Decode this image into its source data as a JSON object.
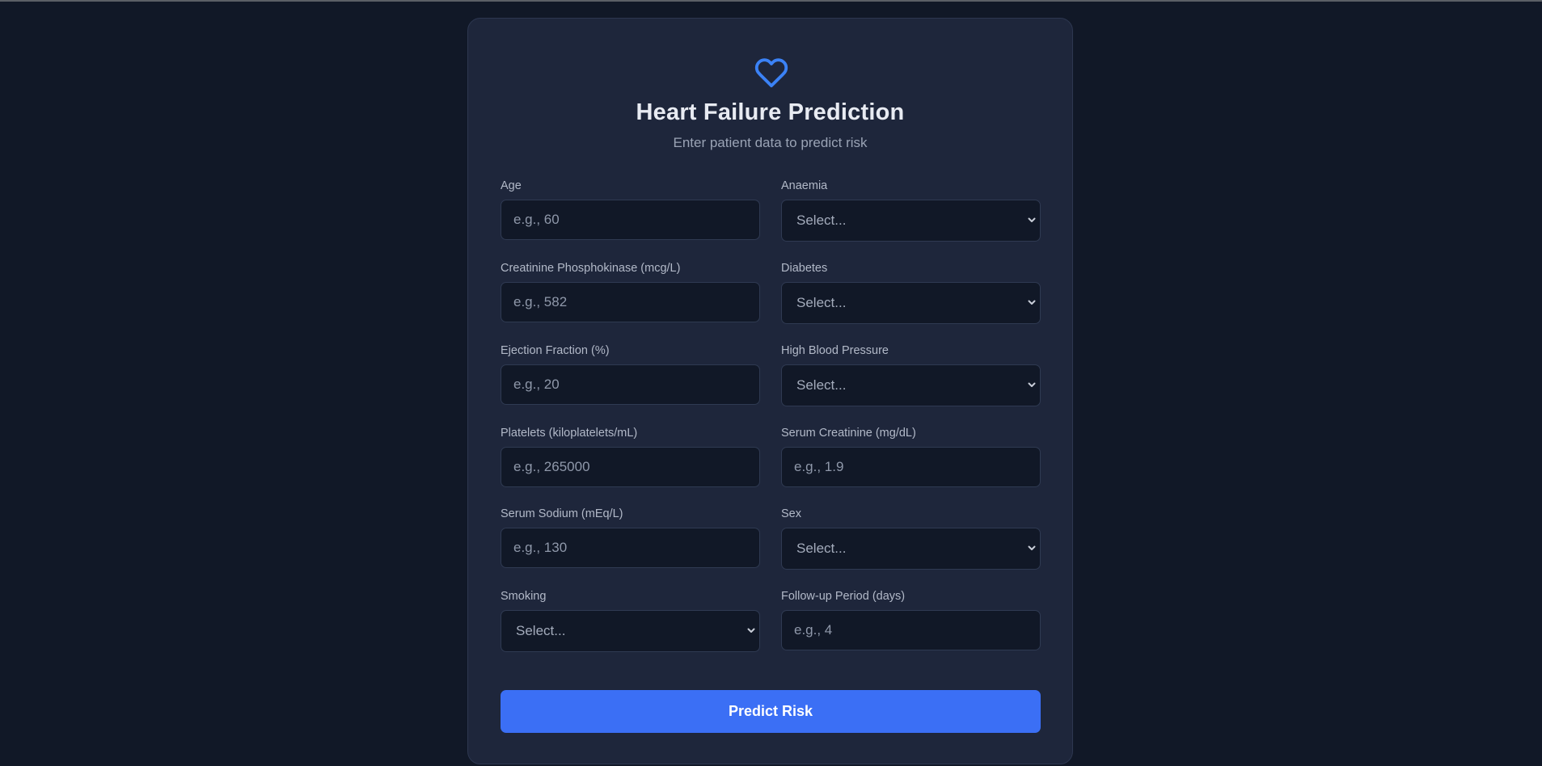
{
  "header": {
    "title": "Heart Failure Prediction",
    "subtitle": "Enter patient data to predict risk",
    "icon": "heart-icon",
    "accent_color": "#3b82f6"
  },
  "form": {
    "age": {
      "label": "Age",
      "placeholder": "e.g., 60"
    },
    "anaemia": {
      "label": "Anaemia",
      "value": "Select..."
    },
    "cpk": {
      "label": "Creatinine Phosphokinase (mcg/L)",
      "placeholder": "e.g., 582"
    },
    "diabetes": {
      "label": "Diabetes",
      "value": "Select..."
    },
    "ejection_fraction": {
      "label": "Ejection Fraction (%)",
      "placeholder": "e.g., 20"
    },
    "high_bp": {
      "label": "High Blood Pressure",
      "value": "Select..."
    },
    "platelets": {
      "label": "Platelets (kiloplatelets/mL)",
      "placeholder": "e.g., 265000"
    },
    "serum_creatinine": {
      "label": "Serum Creatinine (mg/dL)",
      "placeholder": "e.g., 1.9"
    },
    "serum_sodium": {
      "label": "Serum Sodium (mEq/L)",
      "placeholder": "e.g., 130"
    },
    "sex": {
      "label": "Sex",
      "value": "Select..."
    },
    "smoking": {
      "label": "Smoking",
      "value": "Select..."
    },
    "follow_up": {
      "label": "Follow-up Period (days)",
      "placeholder": "e.g., 4"
    }
  },
  "submit": {
    "label": "Predict Risk",
    "color": "#3b6ff5"
  }
}
